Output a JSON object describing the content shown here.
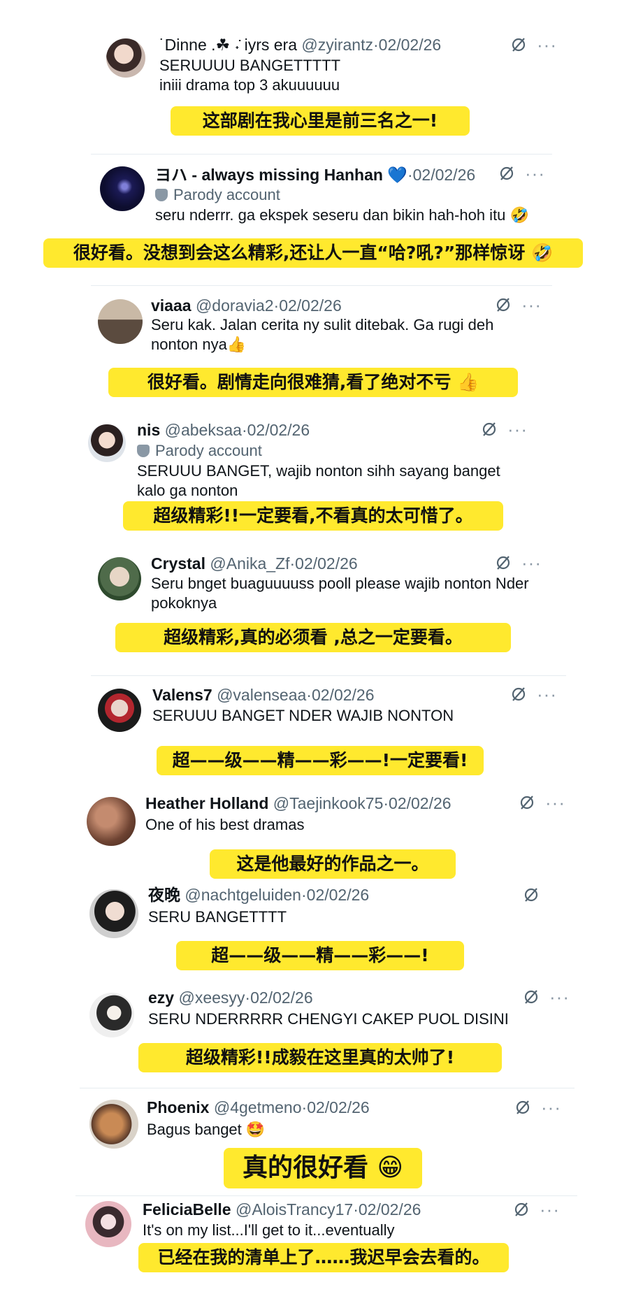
{
  "colors": {
    "highlight": "#ffe92e",
    "muted": "#536471",
    "text": "#0f1419"
  },
  "tweets": [
    {
      "name": "˙Dinne .☘︎ ݁˖ iyrs era",
      "handle": "@zyirantz",
      "date": "02/02/26",
      "text": "SERUUUU BANGETTTTT\niniii drama top 3 akuuuuuu",
      "translation": "这部剧在我心里是前三名之一!"
    },
    {
      "name": "ヨハ - always missing Hanhan 💙",
      "handle": "",
      "date": "02/02/26",
      "parody": "Parody account",
      "text": "seru nderrr. ga ekspek seseru dan bikin hah-hoh itu 🤣",
      "translation": "很好看。没想到会这么精彩,还让人一直“哈?吼?”那样惊讶 🤣"
    },
    {
      "name": "viaaa",
      "handle": "@doravia2",
      "date": "02/02/26",
      "text": "Seru kak. Jalan cerita ny sulit ditebak. Ga rugi deh\nnonton nya👍",
      "translation": "很好看。剧情走向很难猜,看了绝对不亏 👍"
    },
    {
      "name": "nis",
      "handle": "@abeksaa",
      "date": "02/02/26",
      "parody": "Parody account",
      "text": "SERUUU BANGET, wajib nonton sihh sayang banget\nkalo ga nonton",
      "translation": "超级精彩!!一定要看,不看真的太可惜了。"
    },
    {
      "name": "Crystal",
      "handle": "@Anika_Zf",
      "date": "02/02/26",
      "text": "Seru bnget buaguuuuss pooll please wajib nonton Nder\npokoknya",
      "translation": "超级精彩,真的必须看 ,总之一定要看。"
    },
    {
      "name": "Valens7",
      "handle": "@valenseaa",
      "date": "02/02/26",
      "text": "SERUUU BANGET NDER WAJIB NONTON",
      "translation": "超——级——精——彩——!一定要看!"
    },
    {
      "name": "Heather Holland",
      "handle": "@Taejinkook75",
      "date": "02/02/26",
      "text": "One of his best dramas",
      "translation": "这是他最好的作品之一。"
    },
    {
      "name": "夜晚",
      "handle": "@nachtgeluiden",
      "date": "02/02/26",
      "text": "SERU BANGETTTT",
      "translation": "超——级——精——彩——!"
    },
    {
      "name": "ezy",
      "handle": "@xeesyy",
      "date": "02/02/26",
      "text": "SERU NDERRRRR CHENGYI CAKEP PUOL DISINI",
      "translation": "超级精彩!!成毅在这里真的太帅了!"
    },
    {
      "name": "Phoenix",
      "handle": "@4getmeno",
      "date": "02/02/26",
      "text": "Bagus banget 🤩",
      "translation": "真的很好看 😁"
    },
    {
      "name": "FeliciaBelle",
      "handle": "@AloisTrancy17",
      "date": "02/02/26",
      "text": "It's on my list...I'll get to it...eventually",
      "translation": "已经在我的清单上了……我迟早会去看的。"
    }
  ],
  "icons": {
    "grok": "grok-icon",
    "more": "more-options-icon",
    "parody": "mask-icon"
  },
  "glyphs": {
    "dot": "·",
    "more": "···"
  }
}
